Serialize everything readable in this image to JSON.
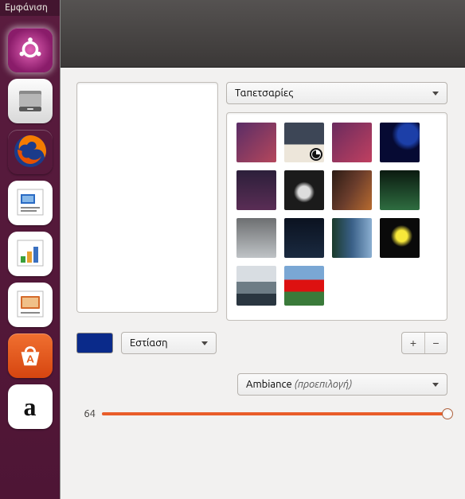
{
  "launcher": {
    "header_label": "Εμφάνιση",
    "items": [
      {
        "name": "ubuntu-dash",
        "active": true
      },
      {
        "name": "files"
      },
      {
        "name": "firefox"
      },
      {
        "name": "libreoffice-writer"
      },
      {
        "name": "libreoffice-calc"
      },
      {
        "name": "libreoffice-impress"
      },
      {
        "name": "ubuntu-software"
      },
      {
        "name": "amazon"
      }
    ]
  },
  "appearance": {
    "wallpaper_source_label": "Ταπετσαρίες",
    "thumbnails": [
      {
        "id": "wp1",
        "bg": "linear-gradient(135deg,#5a2d66,#b5475c)",
        "clock": false
      },
      {
        "id": "wp2",
        "bg": "linear-gradient(#3d4656 55%, #ede6da 55%)",
        "clock": true
      },
      {
        "id": "wp3",
        "bg": "linear-gradient(135deg,#6a2b5e,#c04060)",
        "clock": false
      },
      {
        "id": "wp4",
        "bg": "radial-gradient(circle at 70% 30%, #1c3fa8 0 25%, #060a33 40%)",
        "clock": false
      },
      {
        "id": "wp5",
        "bg": "linear-gradient(#2c1f3a,#5a2d55)",
        "clock": false
      },
      {
        "id": "wp6",
        "bg": "radial-gradient(circle at 50% 55%, #ddd 0 20%, #1b1b1b 35%)",
        "clock": false
      },
      {
        "id": "wp7",
        "bg": "linear-gradient(120deg,#2b1b14,#6b3d2c,#b86b2f)",
        "clock": false
      },
      {
        "id": "wp8",
        "bg": "linear-gradient(#0b1a10,#2e6d40)",
        "clock": false
      },
      {
        "id": "wp9",
        "bg": "linear-gradient(#6d6f71,#bfc3c6)",
        "clock": false
      },
      {
        "id": "wp10",
        "bg": "linear-gradient(#0b1220,#1a2a40)",
        "clock": false
      },
      {
        "id": "wp11",
        "bg": "linear-gradient(90deg,#1a3a2a,#3a6088,#8aaed0)",
        "clock": false
      },
      {
        "id": "wp12",
        "bg": "radial-gradient(circle at 55% 45%, #f7e83a 0 18%, #0a0a0a 35%)",
        "clock": false
      },
      {
        "id": "wp13",
        "bg": "linear-gradient(#d8dde2 40%, #6d7c85 40% 70%, #2a3640 70%)",
        "clock": false
      },
      {
        "id": "wp14",
        "bg": "linear-gradient(#7aa7d4 35%, #d11 35% 65%, #3a7a3a 65%)",
        "clock": false
      }
    ],
    "color_hex": "#0a2a8a",
    "fit_mode_label": "Εστίαση",
    "add_label": "+",
    "remove_label": "−",
    "theme_label": "Ambiance",
    "theme_suffix": "(προεπιλογή)",
    "slider_value": 64,
    "slider_min": 16,
    "slider_max": 64
  }
}
